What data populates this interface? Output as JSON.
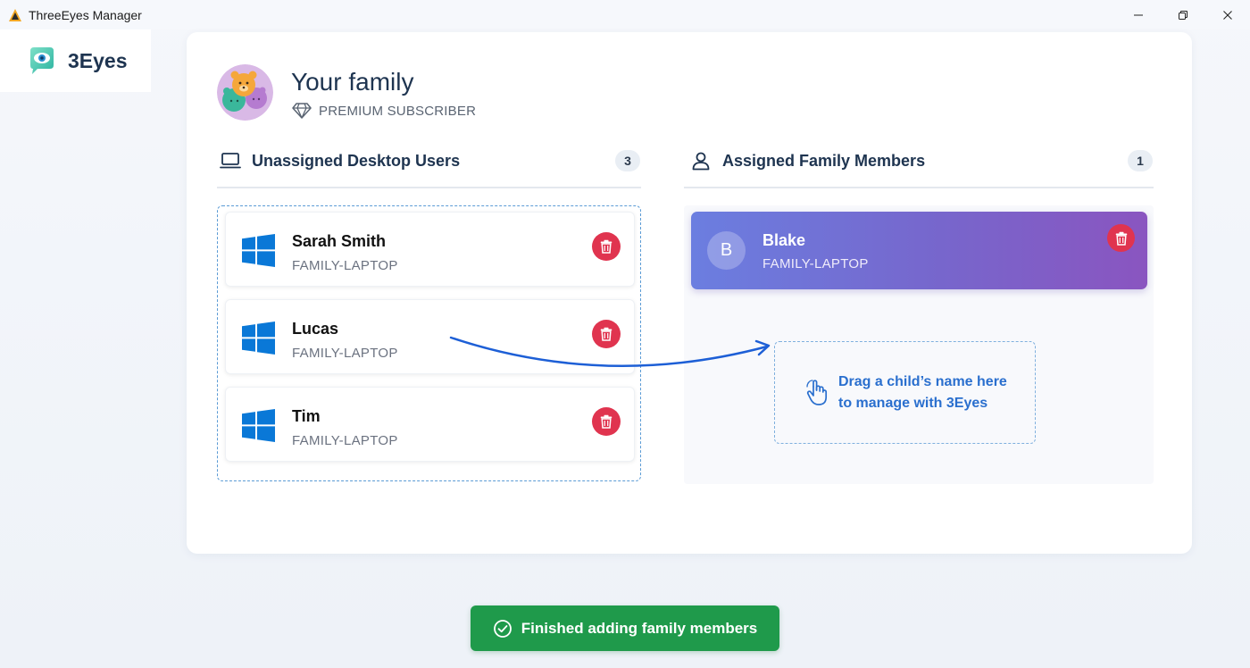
{
  "window": {
    "title": "ThreeEyes Manager",
    "icon": "app-icon"
  },
  "brand": {
    "name": "3Eyes",
    "icon": "eye-bubble-logo-icon"
  },
  "family": {
    "title": "Your family",
    "subscription": "PREMIUM SUBSCRIBER",
    "subscription_icon": "diamond-icon"
  },
  "unassigned": {
    "header": "Unassigned Desktop Users",
    "count": "3",
    "icon": "laptop-icon",
    "users": [
      {
        "name": "Sarah Smith",
        "device": "FAMILY-LAPTOP"
      },
      {
        "name": "Lucas",
        "device": "FAMILY-LAPTOP"
      },
      {
        "name": "Tim",
        "device": "FAMILY-LAPTOP"
      }
    ]
  },
  "assigned": {
    "header": "Assigned Family Members",
    "count": "1",
    "icon": "person-icon",
    "members": [
      {
        "initial": "B",
        "name": "Blake",
        "device": "FAMILY-LAPTOP"
      }
    ],
    "drop_hint_line1": "Drag a child’s name here",
    "drop_hint_line2": "to manage with 3Eyes"
  },
  "footer": {
    "finish_label": "Finished adding family members"
  },
  "colors": {
    "accent_blue": "#2a6fce",
    "delete_red": "#e0344f",
    "finish_green": "#1f9a4b",
    "member_gradient_start": "#6b7ee0",
    "member_gradient_end": "#8a55c0"
  }
}
